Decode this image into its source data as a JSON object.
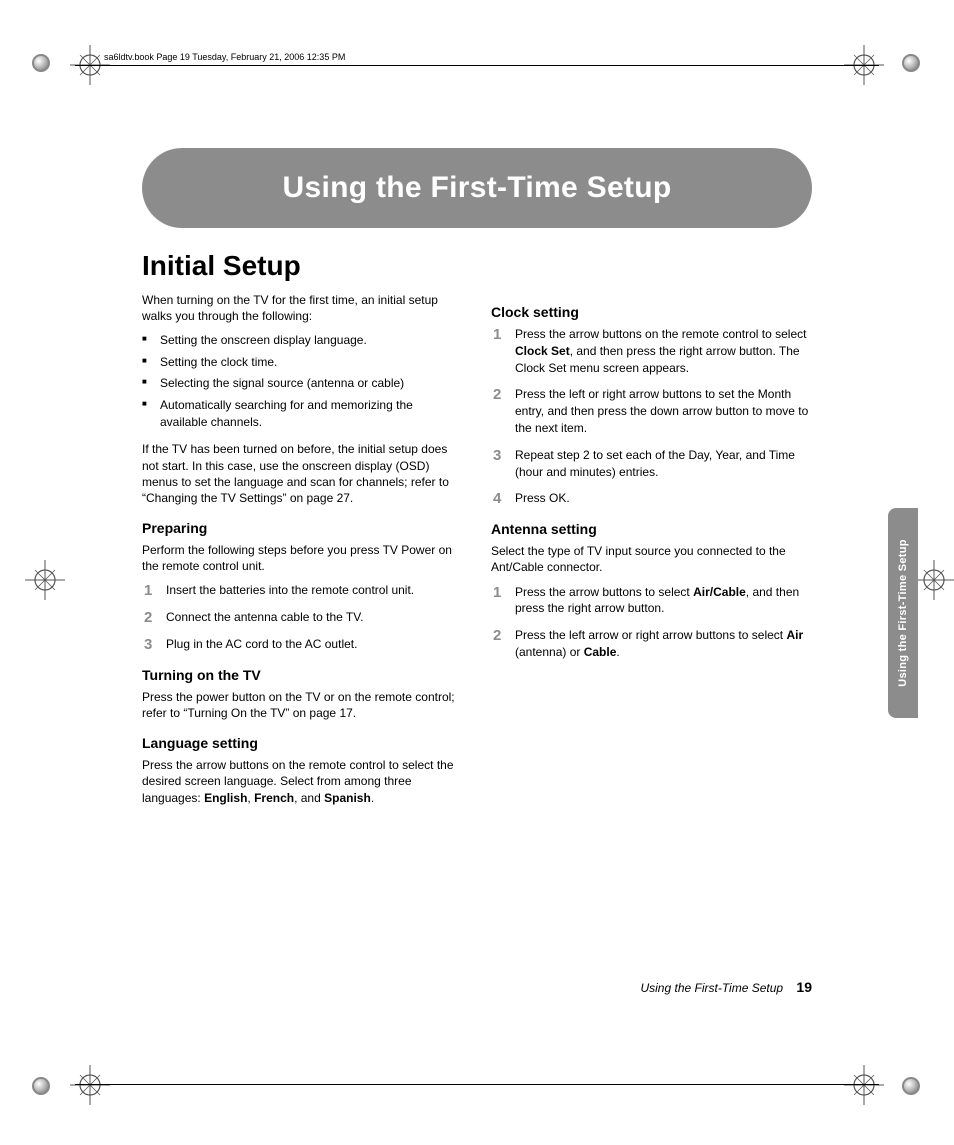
{
  "header": {
    "running": "sa6ldtv.book  Page 19  Tuesday, February 21, 2006  12:35 PM"
  },
  "banner": {
    "title": "Using the First-Time Setup"
  },
  "section_title": "Initial Setup",
  "intro": "When turning on the TV for the first time, an initial setup walks you through the following:",
  "bullets": [
    "Setting the onscreen display language.",
    "Setting the clock time.",
    "Selecting the signal source (antenna or cable)",
    "Automatically searching for and memorizing the available channels."
  ],
  "after_bullets": "If the TV has been turned on before, the initial setup does not start. In this case, use the onscreen display (OSD) menus to set the language and scan for channels; refer to “Changing the TV Settings” on page 27.",
  "preparing": {
    "heading": "Preparing",
    "body": "Perform the following steps before you press TV Power on the remote control unit.",
    "steps": [
      "Insert the batteries into the remote control unit.",
      "Connect the antenna cable to the TV.",
      "Plug in the AC cord to the AC outlet."
    ]
  },
  "turning_on": {
    "heading": "Turning on the TV",
    "body": "Press the power button on the TV or on the remote control; refer to “Turning On the TV” on page 17."
  },
  "language": {
    "heading": "Language setting",
    "body_pre": "Press the arrow buttons on the remote control to select the desired screen language. Select from among three languages: ",
    "lang1": "English",
    "lang2": "French",
    "lang3": "Spanish"
  },
  "clock": {
    "heading": "Clock setting",
    "steps": {
      "s1_pre": "Press the arrow buttons on the remote control to select ",
      "s1_bold": "Clock Set",
      "s1_post": ", and then press the right arrow button. The Clock Set menu screen appears.",
      "s2": "Press the left or right arrow buttons to set the Month entry, and then press the down arrow button to move to the next item.",
      "s3": "Repeat step 2 to set each of the Day, Year, and Time (hour and minutes) entries.",
      "s4": "Press OK."
    }
  },
  "antenna": {
    "heading": "Antenna setting",
    "body": "Select the type of TV input source you connected to the Ant/Cable connector.",
    "s1_pre": "Press the arrow buttons to select ",
    "s1_bold": "Air/Cable",
    "s1_post": ", and then press the right arrow button.",
    "s2_pre": "Press the left arrow or right arrow buttons to select ",
    "s2_b1": "Air",
    "s2_mid": " (antenna) or ",
    "s2_b2": "Cable",
    "s2_post": "."
  },
  "side_tab": "Using the First-Time Setup",
  "footer": {
    "title": "Using the First-Time Setup",
    "page": "19"
  }
}
